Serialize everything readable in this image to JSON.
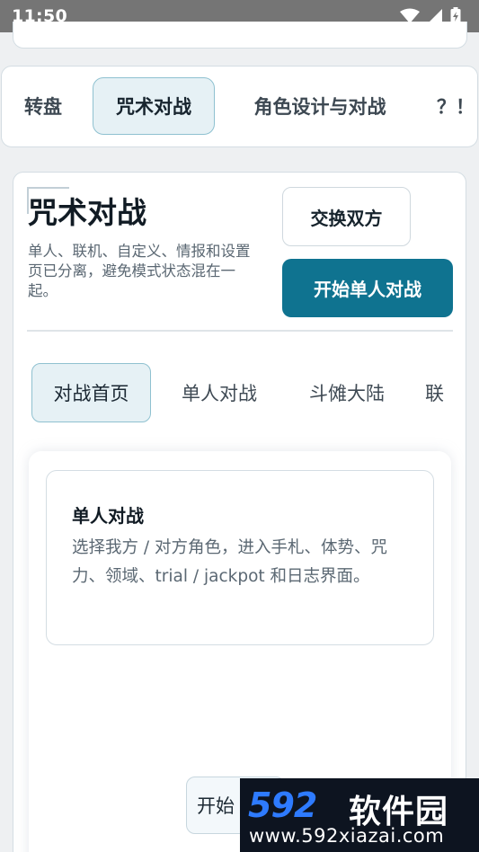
{
  "status_bar": {
    "time": "11:50",
    "icons": [
      "wifi-icon",
      "signal-icon",
      "battery-charging-icon"
    ]
  },
  "module_nav": {
    "tabs": [
      {
        "label": "转盘",
        "active": false
      },
      {
        "label": "咒术对战",
        "active": true
      },
      {
        "label": "角色设计与对战",
        "active": false
      },
      {
        "label": "？！",
        "active": false
      }
    ]
  },
  "panel": {
    "title": "咒术对战",
    "description": "单人、联机、自定义、情报和设置页已分离，避免模式状态混在一起。",
    "swap_button": "交换双方",
    "start_button": "开始单人对战",
    "sub_tabs": [
      {
        "label": "对战首页",
        "active": true
      },
      {
        "label": "单人对战",
        "active": false
      },
      {
        "label": "斗傩大陆",
        "active": false
      },
      {
        "label": "联",
        "active": false
      }
    ],
    "card": {
      "title": "单人对战",
      "text": "选择我方 / 对方角色，进入手札、体势、咒力、领域、trial / jackpot 和日志界面。"
    },
    "floating_button": "开始"
  },
  "watermark": {
    "logo": "592",
    "brand": "软件园",
    "url": "www.592xiazai.com"
  },
  "colors": {
    "accent": "#0f7390",
    "active_tab_bg": "#e6f1f5",
    "active_tab_border": "#8fc1d0",
    "watermark_blue": "#2e7bff"
  }
}
